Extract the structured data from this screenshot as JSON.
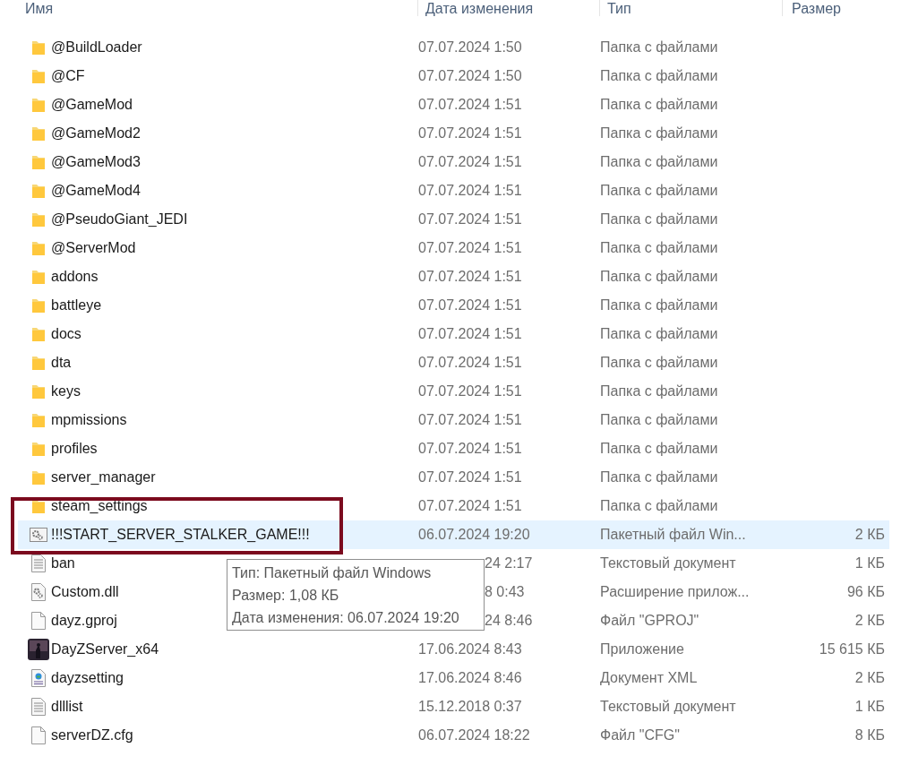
{
  "columns": [
    "Имя",
    "Дата изменения",
    "Тип",
    "Размер"
  ],
  "rows": [
    {
      "kind": "folder",
      "name": "@BuildLoader",
      "date": "07.07.2024 1:50",
      "type": "Папка с файлами",
      "selected": false
    },
    {
      "kind": "folder",
      "name": "@CF",
      "date": "07.07.2024 1:50",
      "type": "Папка с файлами",
      "selected": false
    },
    {
      "kind": "folder",
      "name": "@GameMod",
      "date": "07.07.2024 1:51",
      "type": "Папка с файлами",
      "selected": false
    },
    {
      "kind": "folder",
      "name": "@GameMod2",
      "date": "07.07.2024 1:51",
      "type": "Папка с файлами",
      "selected": false
    },
    {
      "kind": "folder",
      "name": "@GameMod3",
      "date": "07.07.2024 1:51",
      "type": "Папка с файлами",
      "selected": false
    },
    {
      "kind": "folder",
      "name": "@GameMod4",
      "date": "07.07.2024 1:51",
      "type": "Папка с файлами",
      "selected": false
    },
    {
      "kind": "folder",
      "name": "@PseudoGiant_JEDI",
      "date": "07.07.2024 1:51",
      "type": "Папка с файлами",
      "selected": false
    },
    {
      "kind": "folder",
      "name": "@ServerMod",
      "date": "07.07.2024 1:51",
      "type": "Папка с файлами",
      "selected": false
    },
    {
      "kind": "folder",
      "name": "addons",
      "date": "07.07.2024 1:51",
      "type": "Папка с файлами",
      "selected": false
    },
    {
      "kind": "folder",
      "name": "battleye",
      "date": "07.07.2024 1:51",
      "type": "Папка с файлами",
      "selected": false
    },
    {
      "kind": "folder",
      "name": "docs",
      "date": "07.07.2024 1:51",
      "type": "Папка с файлами",
      "selected": false
    },
    {
      "kind": "folder",
      "name": "dta",
      "date": "07.07.2024 1:51",
      "type": "Папка с файлами",
      "selected": false
    },
    {
      "kind": "folder",
      "name": "keys",
      "date": "07.07.2024 1:51",
      "type": "Папка с файлами",
      "selected": false
    },
    {
      "kind": "folder",
      "name": "mpmissions",
      "date": "07.07.2024 1:51",
      "type": "Папка с файлами",
      "selected": false
    },
    {
      "kind": "folder",
      "name": "profiles",
      "date": "07.07.2024 1:51",
      "type": "Папка с файлами",
      "selected": false
    },
    {
      "kind": "folder",
      "name": "server_manager",
      "date": "07.07.2024 1:51",
      "type": "Папка с файлами",
      "selected": false
    },
    {
      "kind": "folder",
      "name": "steam_settings",
      "date": "07.07.2024 1:51",
      "type": "Папка с файлами",
      "selected": false
    },
    {
      "kind": "batch",
      "name": "!!!START_SERVER_STALKER_GAME!!!",
      "date": "06.07.2024 19:20",
      "type": "Пакетный файл Win...",
      "size": "2 КБ",
      "selected": true
    },
    {
      "kind": "text",
      "name": "ban",
      "date": "24 2:17",
      "date_covered": true,
      "type": "Текстовый документ",
      "size": "1 КБ",
      "selected": false
    },
    {
      "kind": "dll",
      "name": "Custom.dll",
      "date": "8 0:43",
      "date_covered": true,
      "type": "Расширение прилож...",
      "size": "96 КБ",
      "selected": false
    },
    {
      "kind": "file",
      "name": "dayz.gproj",
      "date": "24 8:46",
      "date_covered": true,
      "type": "Файл \"GPROJ\"",
      "size": "2 КБ",
      "selected": false
    },
    {
      "kind": "app",
      "name": "DayZServer_x64",
      "date": "17.06.2024 8:43",
      "type": "Приложение",
      "size": "15 615 КБ",
      "selected": false
    },
    {
      "kind": "xml",
      "name": "dayzsetting",
      "date": "17.06.2024 8:46",
      "type": "Документ XML",
      "size": "2 КБ",
      "selected": false
    },
    {
      "kind": "text",
      "name": "dlllist",
      "date": "15.12.2018 0:37",
      "type": "Текстовый документ",
      "size": "1 КБ",
      "selected": false
    },
    {
      "kind": "file",
      "name": "serverDZ.cfg",
      "date": "06.07.2024 18:22",
      "type": "Файл \"CFG\"",
      "size": "8 КБ",
      "selected": false
    }
  ],
  "tooltip": {
    "lines": [
      "Тип: Пакетный файл Windows",
      "Размер: 1,08 КБ",
      "Дата изменения: 06.07.2024 19:20"
    ]
  },
  "highlight_box": {
    "shown": true
  }
}
